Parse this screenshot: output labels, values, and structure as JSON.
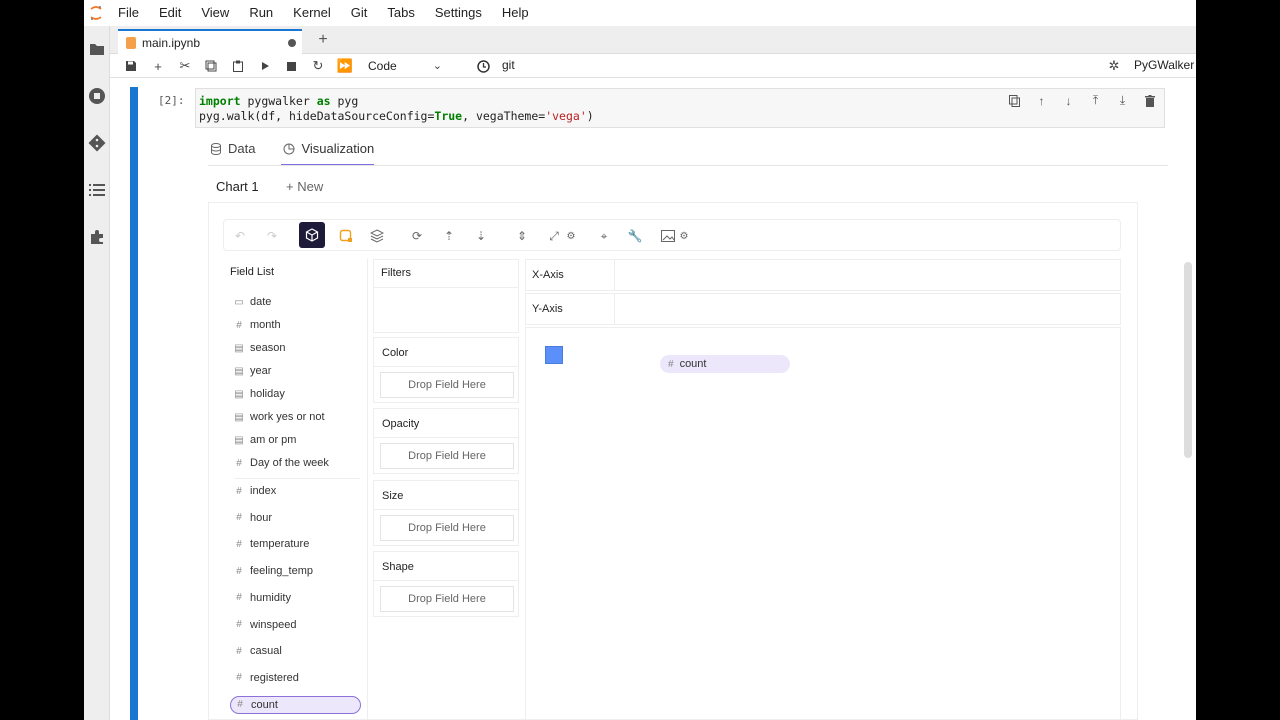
{
  "menu": [
    "File",
    "Edit",
    "View",
    "Run",
    "Kernel",
    "Git",
    "Tabs",
    "Settings",
    "Help"
  ],
  "tab": {
    "title": "main.ipynb"
  },
  "toolbar": {
    "cell_type": "Code",
    "git_label": "git",
    "kernel_name": "PyGWalker"
  },
  "cell": {
    "prompt": "[2]:",
    "line1": {
      "kw1": "import",
      "mod": " pygwalker ",
      "kw2": "as",
      "alias": " pyg"
    },
    "line2": {
      "pre": "pyg.walk(df, hideDataSourceConfig=",
      "true": "True",
      "mid": ", vegaTheme=",
      "str": "'vega'",
      "post": ")"
    }
  },
  "pyg": {
    "tabs": [
      "Data",
      "Visualization"
    ],
    "chart_tab": "Chart 1",
    "new_tab": "+ New",
    "field_list_title": "Field List",
    "dimensions": [
      {
        "name": "date",
        "type": "date"
      },
      {
        "name": "month",
        "type": "#"
      },
      {
        "name": "season",
        "type": "text"
      },
      {
        "name": "year",
        "type": "text"
      },
      {
        "name": "holiday",
        "type": "text"
      },
      {
        "name": "work yes or not",
        "type": "text"
      },
      {
        "name": "am or pm",
        "type": "text"
      },
      {
        "name": "Day of the week",
        "type": "#"
      }
    ],
    "measures": [
      {
        "name": "index",
        "type": "#"
      },
      {
        "name": "hour",
        "type": "#"
      },
      {
        "name": "temperature",
        "type": "#"
      },
      {
        "name": "feeling_temp",
        "type": "#"
      },
      {
        "name": "humidity",
        "type": "#"
      },
      {
        "name": "winspeed",
        "type": "#"
      },
      {
        "name": "casual",
        "type": "#"
      },
      {
        "name": "registered",
        "type": "#"
      },
      {
        "name": "count",
        "type": "#"
      }
    ],
    "filters_title": "Filters",
    "channels": [
      {
        "title": "Color",
        "drop": "Drop Field Here"
      },
      {
        "title": "Opacity",
        "drop": "Drop Field Here"
      },
      {
        "title": "Size",
        "drop": "Drop Field Here"
      },
      {
        "title": "Shape",
        "drop": "Drop Field Here"
      }
    ],
    "x_axis": "X-Axis",
    "y_axis": "Y-Axis",
    "drag_pill": {
      "type": "#",
      "name": "count"
    },
    "accent": "#7c6fe0",
    "mark_color": "#5b8ff9"
  }
}
